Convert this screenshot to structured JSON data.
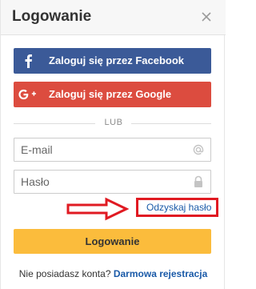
{
  "dialog": {
    "title": "Logowanie"
  },
  "social": {
    "facebook_label": "Zaloguj się przez Facebook",
    "google_label": "Zaloguj się przez Google",
    "facebook_icon": "facebook-icon",
    "google_icon": "google-plus-icon"
  },
  "divider": {
    "label": "LUB"
  },
  "form": {
    "email_placeholder": "E-mail",
    "password_placeholder": "Hasło",
    "email_value": "",
    "password_value": "",
    "recover_label": "Odzyskaj hasło",
    "login_label": "Logowanie"
  },
  "footer": {
    "prompt": "Nie posiadasz konta?",
    "register_label": "Darmowa rejestracja"
  },
  "colors": {
    "facebook": "#3b5a98",
    "google": "#dc4c3f",
    "login_button": "#fbbc3c",
    "link": "#1a5aa8",
    "annotation": "#e01a22"
  }
}
